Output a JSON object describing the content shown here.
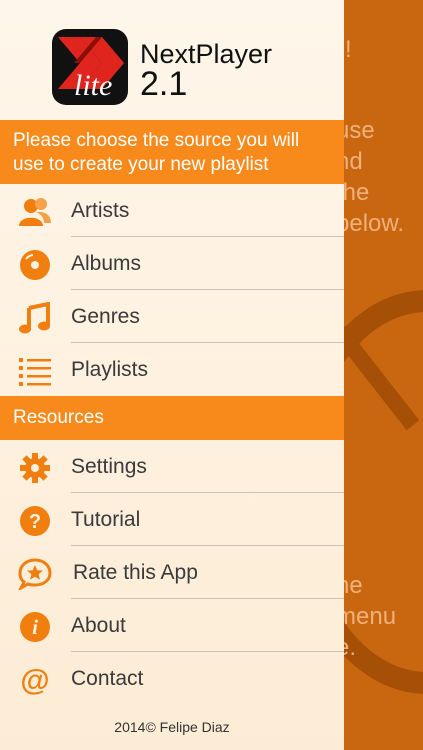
{
  "background": {
    "exclaim": "!",
    "text_top": "use\nnd\nthe\nbelow.",
    "text_bottom": "he\nmenu\ne."
  },
  "header": {
    "logo_text": "lite",
    "app_name": "NextPlayer",
    "version": "2.1"
  },
  "choose_banner": "Please choose the source you will use to create your new playlist",
  "source_items": [
    {
      "label": "Artists",
      "icon": "artists-icon"
    },
    {
      "label": "Albums",
      "icon": "album-icon"
    },
    {
      "label": "Genres",
      "icon": "music-note-icon"
    },
    {
      "label": "Playlists",
      "icon": "list-icon"
    }
  ],
  "resources_banner": "Resources",
  "resource_items": [
    {
      "label": "Settings",
      "icon": "gear-icon"
    },
    {
      "label": "Tutorial",
      "icon": "question-icon"
    },
    {
      "label": "Rate this App",
      "icon": "star-chat-icon"
    },
    {
      "label": "About",
      "icon": "info-icon"
    },
    {
      "label": "Contact",
      "icon": "at-icon"
    }
  ],
  "footer": "2014© Felipe Diaz",
  "colors": {
    "accent": "#f88a1c",
    "background": "#c8670f"
  }
}
